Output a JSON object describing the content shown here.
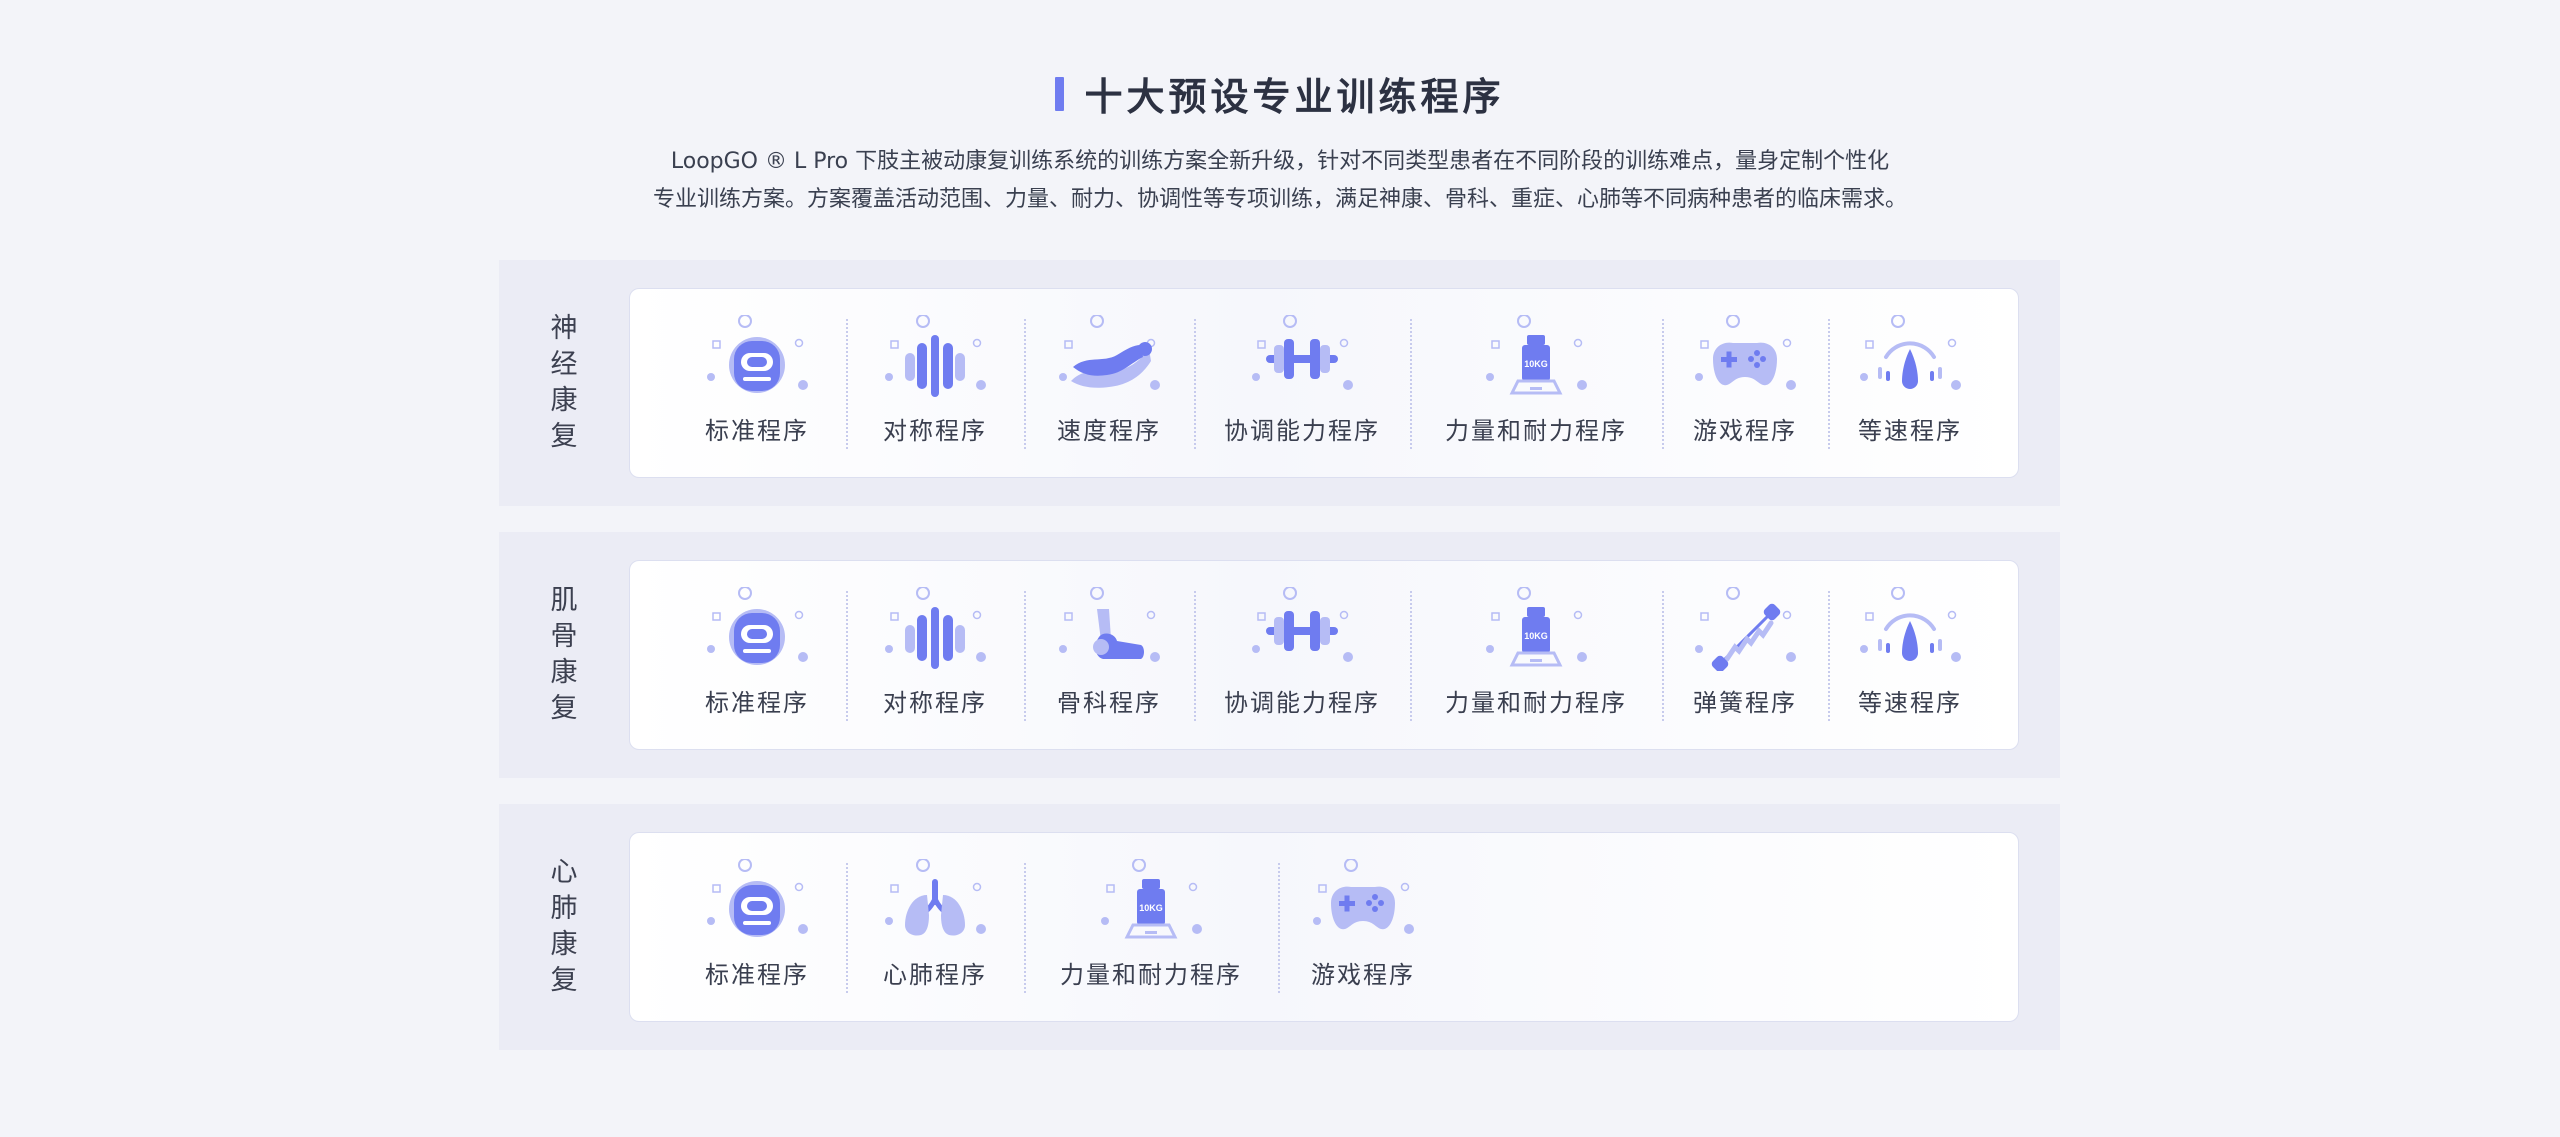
{
  "header": {
    "title": "十大预设专业训练程序",
    "desc_line1": "LoopGO ® L Pro 下肢主被动康复训练系统的训练方案全新升级，针对不同类型患者在不同阶段的训练难点，量身定制个性化",
    "desc_line2": "专业训练方案。方案覆盖活动范围、力量、耐力、协调性等专项训练，满足神康、骨科、重症、心肺等不同病种患者的临床需求。"
  },
  "colors": {
    "accent": "#6f7cf0",
    "icon_light": "#b6bcf5",
    "background": "#f3f4f9",
    "section": "#ebecf5"
  },
  "sections": [
    {
      "label": [
        "神",
        "经",
        "康",
        "复"
      ],
      "items": [
        {
          "label": "标准程序",
          "icon": "robot-icon"
        },
        {
          "label": "对称程序",
          "icon": "symmetry-icon"
        },
        {
          "label": "速度程序",
          "icon": "speed-icon"
        },
        {
          "label": "协调能力程序",
          "icon": "dumbbell-icon"
        },
        {
          "label": "力量和耐力程序",
          "icon": "weight-icon",
          "weight_text": "10KG"
        },
        {
          "label": "游戏程序",
          "icon": "gamepad-icon"
        },
        {
          "label": "等速程序",
          "icon": "gauge-icon"
        }
      ]
    },
    {
      "label": [
        "肌",
        "骨",
        "康",
        "复"
      ],
      "items": [
        {
          "label": "标准程序",
          "icon": "robot-icon"
        },
        {
          "label": "对称程序",
          "icon": "symmetry-icon"
        },
        {
          "label": "骨科程序",
          "icon": "bone-joint-icon"
        },
        {
          "label": "协调能力程序",
          "icon": "dumbbell-icon"
        },
        {
          "label": "力量和耐力程序",
          "icon": "weight-icon",
          "weight_text": "10KG"
        },
        {
          "label": "弹簧程序",
          "icon": "spring-icon"
        },
        {
          "label": "等速程序",
          "icon": "gauge-icon"
        }
      ]
    },
    {
      "label": [
        "心",
        "肺",
        "康",
        "复"
      ],
      "items": [
        {
          "label": "标准程序",
          "icon": "robot-icon"
        },
        {
          "label": "心肺程序",
          "icon": "lungs-icon"
        },
        {
          "label": "力量和耐力程序",
          "icon": "weight-icon",
          "weight_text": "10KG"
        },
        {
          "label": "游戏程序",
          "icon": "gamepad-icon"
        }
      ]
    }
  ]
}
